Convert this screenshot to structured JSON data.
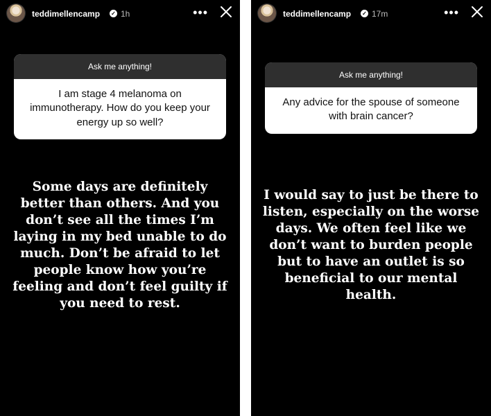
{
  "stories": [
    {
      "username": "teddimellencamp",
      "time": "1h",
      "more_icon": "•••",
      "question_header": "Ask me anything!",
      "question": "I am stage 4 melanoma on immunotherapy. How do you keep your energy up so well?",
      "answer": "Some days are definitely better than others. And you don’t see all the times I’m laying in my bed unable to do much. Don’t be afraid to let people know how you’re feeling and don’t feel guilty if you need to rest."
    },
    {
      "username": "teddimellencamp",
      "time": "17m",
      "more_icon": "•••",
      "question_header": "Ask me anything!",
      "question": "Any advice for the spouse of someone with brain cancer?",
      "answer": "I would say to just be there to listen, especially on the worse days. We often feel like we don’t want to burden people but to have an outlet is so beneficial to our mental health."
    }
  ],
  "colors": {
    "story_background": "#000000",
    "question_header_bg": "#2f2f2f",
    "card_bg": "#ffffff"
  }
}
